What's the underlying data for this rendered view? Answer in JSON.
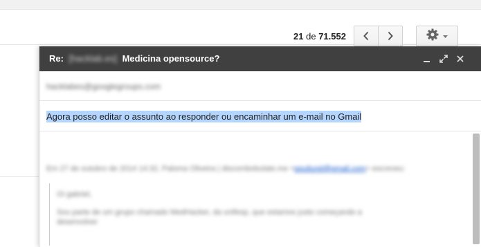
{
  "toolbar": {
    "pager": {
      "current": "21",
      "of": "de",
      "total": "71.552"
    },
    "prev_icon": "chevron-left-icon",
    "next_icon": "chevron-right-icon",
    "settings_icon": "gear-icon"
  },
  "compose": {
    "title_prefix": "Re:",
    "title_blurred": "[hacklab.es]",
    "title_suffix": "Medicina opensource?",
    "controls": [
      "minimize-icon",
      "expand-icon",
      "close-icon"
    ],
    "to": "hacklabes@googlegroups.com",
    "subject": "Agora posso editar o assunto ao responder ou encaminhar um e-mail no Gmail",
    "body": {
      "attribution": "Em 27 de outubro de 2014 14:32, Paloma Oliveira | discombobulate.me <",
      "attribution_link": "pouliurel@gmail.com",
      "attribution_end": "> escreveu:",
      "quote_greeting": "Oi gabriel,",
      "quote_line1": "Sou parte de um grupo chamado MedHacker, da unifesp, que estamos justo começando a",
      "quote_line2": "desenvolver"
    }
  },
  "colors": {
    "header_bg": "#404040",
    "selection": "#b4d5fe",
    "link": "#1155cc"
  }
}
